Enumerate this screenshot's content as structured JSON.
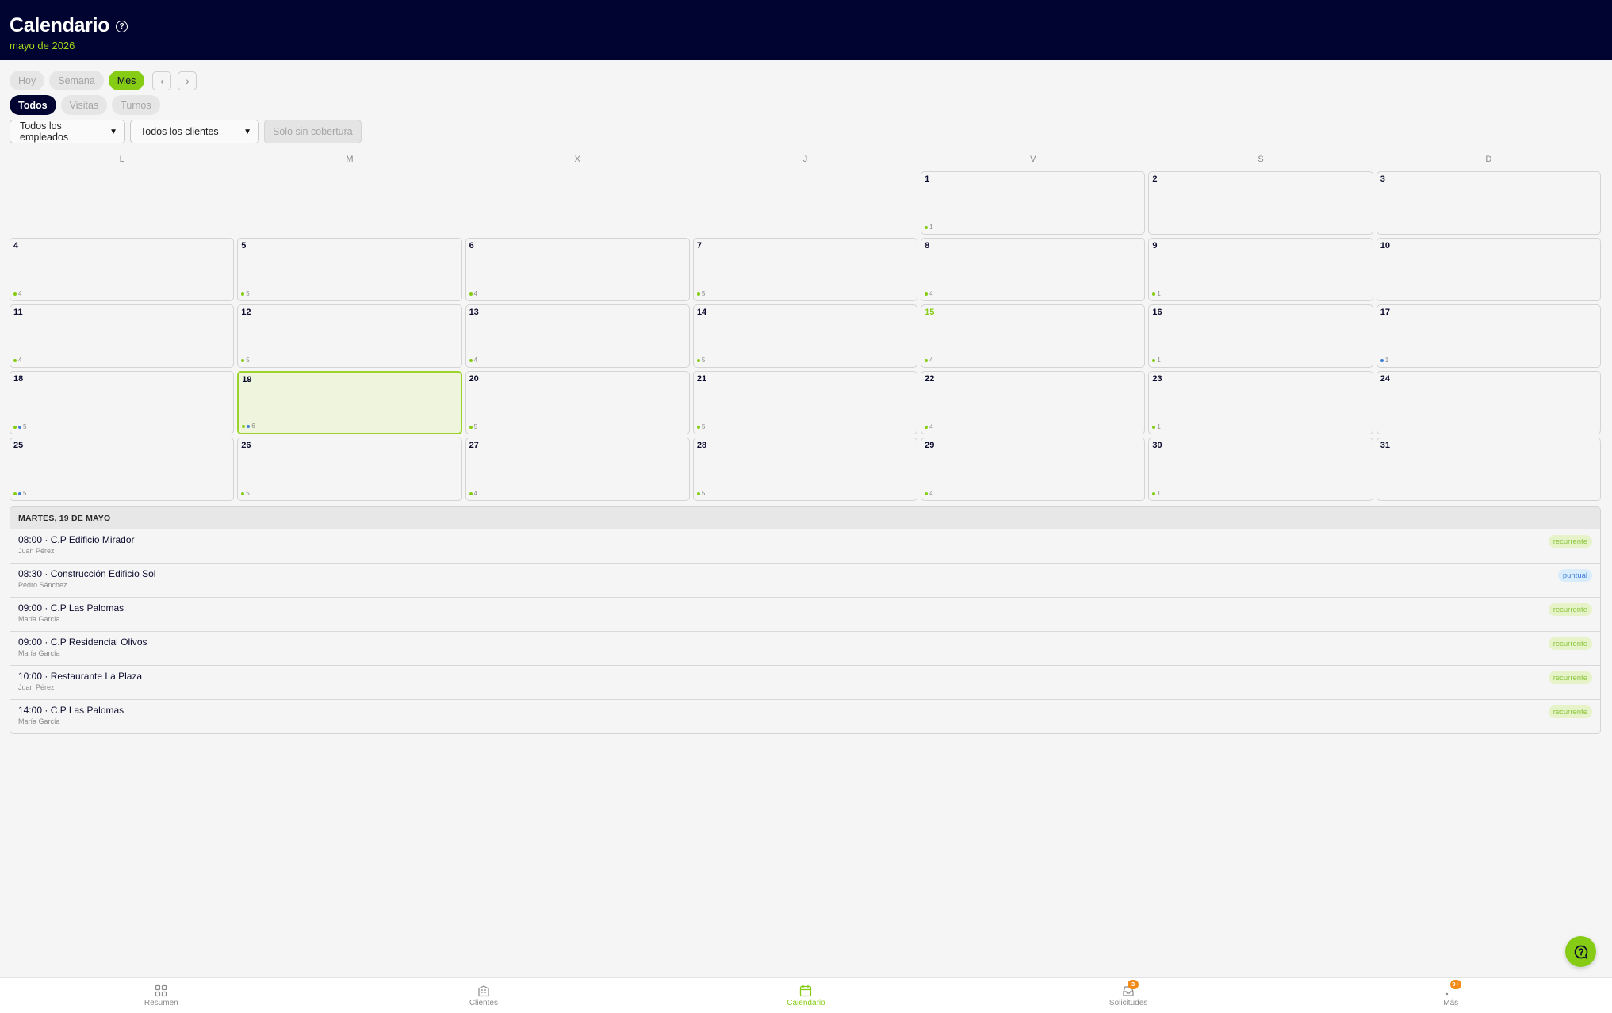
{
  "header": {
    "title": "Calendario",
    "subtitle": "mayo de 2026"
  },
  "view_tabs": [
    {
      "label": "Hoy",
      "active": false
    },
    {
      "label": "Semana",
      "active": false
    },
    {
      "label": "Mes",
      "active": true
    }
  ],
  "nav": {
    "prev_icon": "chevron-left-icon",
    "next_icon": "chevron-right-icon",
    "prev": "‹",
    "next": "›"
  },
  "type_tabs": [
    {
      "label": "Todos",
      "active": true
    },
    {
      "label": "Visitas",
      "active": false
    },
    {
      "label": "Turnos",
      "active": false
    }
  ],
  "filters": {
    "employees": "Todos los empleados",
    "clients": "Todos los clientes",
    "coverage_button": "Solo sin cobertura"
  },
  "weekdays": [
    "L",
    "M",
    "X",
    "J",
    "V",
    "S",
    "D"
  ],
  "calendar": {
    "month": "mayo de 2026",
    "today": 15,
    "selected": 19,
    "days": [
      {
        "day": 1,
        "count": "1",
        "dots": [
          "green"
        ]
      },
      {
        "day": 2,
        "count": "",
        "dots": []
      },
      {
        "day": 3,
        "count": "",
        "dots": []
      },
      {
        "day": 4,
        "count": "4",
        "dots": [
          "green"
        ]
      },
      {
        "day": 5,
        "count": "5",
        "dots": [
          "green"
        ]
      },
      {
        "day": 6,
        "count": "4",
        "dots": [
          "green"
        ]
      },
      {
        "day": 7,
        "count": "5",
        "dots": [
          "green"
        ]
      },
      {
        "day": 8,
        "count": "4",
        "dots": [
          "green"
        ]
      },
      {
        "day": 9,
        "count": "1",
        "dots": [
          "green"
        ]
      },
      {
        "day": 10,
        "count": "",
        "dots": []
      },
      {
        "day": 11,
        "count": "4",
        "dots": [
          "green"
        ]
      },
      {
        "day": 12,
        "count": "5",
        "dots": [
          "green"
        ]
      },
      {
        "day": 13,
        "count": "4",
        "dots": [
          "green"
        ]
      },
      {
        "day": 14,
        "count": "5",
        "dots": [
          "green"
        ]
      },
      {
        "day": 15,
        "count": "4",
        "dots": [
          "green"
        ]
      },
      {
        "day": 16,
        "count": "1",
        "dots": [
          "green"
        ]
      },
      {
        "day": 17,
        "count": "1",
        "dots": [
          "blue"
        ]
      },
      {
        "day": 18,
        "count": "5",
        "dots": [
          "green",
          "blue"
        ]
      },
      {
        "day": 19,
        "count": "6",
        "dots": [
          "green",
          "blue"
        ]
      },
      {
        "day": 20,
        "count": "5",
        "dots": [
          "green"
        ]
      },
      {
        "day": 21,
        "count": "5",
        "dots": [
          "green"
        ]
      },
      {
        "day": 22,
        "count": "4",
        "dots": [
          "green"
        ]
      },
      {
        "day": 23,
        "count": "1",
        "dots": [
          "green"
        ]
      },
      {
        "day": 24,
        "count": "",
        "dots": []
      },
      {
        "day": 25,
        "count": "5",
        "dots": [
          "green",
          "blue"
        ]
      },
      {
        "day": 26,
        "count": "5",
        "dots": [
          "green"
        ]
      },
      {
        "day": 27,
        "count": "4",
        "dots": [
          "green"
        ]
      },
      {
        "day": 28,
        "count": "5",
        "dots": [
          "green"
        ]
      },
      {
        "day": 29,
        "count": "4",
        "dots": [
          "green"
        ]
      },
      {
        "day": 30,
        "count": "1",
        "dots": [
          "green"
        ]
      },
      {
        "day": 31,
        "count": "",
        "dots": []
      }
    ]
  },
  "day_detail": {
    "heading": "MARTES, 19 DE MAYO",
    "items": [
      {
        "title": "08:00 · C.P Edificio Mirador",
        "person": "Juan Pérez",
        "tag": "recurrente",
        "tag_type": "rec"
      },
      {
        "title": "08:30 · Construcción Edificio Sol",
        "person": "Pedro Sánchez",
        "tag": "puntual",
        "tag_type": "pun"
      },
      {
        "title": "09:00 · C.P Las Palomas",
        "person": "María García",
        "tag": "recurrente",
        "tag_type": "rec"
      },
      {
        "title": "09:00 · C.P Residencial Olivos",
        "person": "María García",
        "tag": "recurrente",
        "tag_type": "rec"
      },
      {
        "title": "10:00 · Restaurante La Plaza",
        "person": "Juan Pérez",
        "tag": "recurrente",
        "tag_type": "rec"
      },
      {
        "title": "14:00 · C.P Las Palomas",
        "person": "María García",
        "tag": "recurrente",
        "tag_type": "rec"
      }
    ]
  },
  "bottom_nav": [
    {
      "label": "Resumen",
      "icon": "dashboard-grid-icon",
      "active": false,
      "badge": ""
    },
    {
      "label": "Clientes",
      "icon": "building-icon",
      "active": false,
      "badge": ""
    },
    {
      "label": "Calendario",
      "icon": "calendar-icon",
      "active": true,
      "badge": ""
    },
    {
      "label": "Solicitudes",
      "icon": "inbox-icon",
      "active": false,
      "badge": "3"
    },
    {
      "label": "Más",
      "icon": "more-icon",
      "active": false,
      "badge": "9+"
    }
  ],
  "colors": {
    "header_bg": "#010330",
    "accent": "#86cc14",
    "secondary_dot": "#3f7ed8",
    "badge": "#f28b1a"
  }
}
